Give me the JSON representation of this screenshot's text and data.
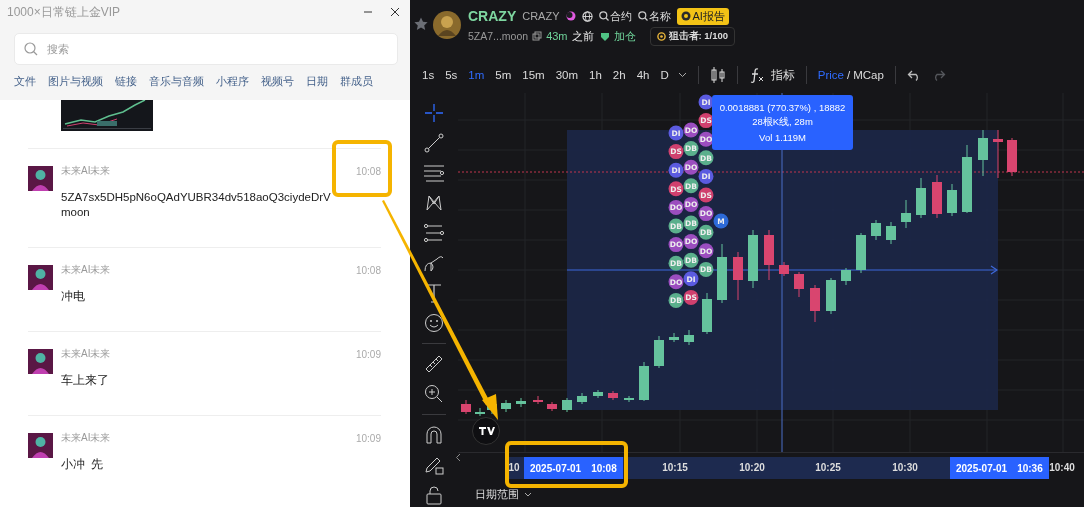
{
  "chat": {
    "title": "1000×日常链上金VIP",
    "search": {
      "placeholder": "搜索"
    },
    "tabs": [
      {
        "label": "文件"
      },
      {
        "label": "图片与视频"
      },
      {
        "label": "链接"
      },
      {
        "label": "音乐与音频"
      },
      {
        "label": "小程序"
      },
      {
        "label": "视频号"
      },
      {
        "label": "日期"
      },
      {
        "label": "群成员"
      }
    ],
    "messages": [
      {
        "sender": "未来AI未来",
        "time": "10:08",
        "text": "5ZA7sx5DH5pN6oQAdYUBR34dv518aoQ3ciydeDrVmoon"
      },
      {
        "sender": "未来AI未来",
        "time": "10:08",
        "text": "冲电"
      },
      {
        "sender": "未来AI未来",
        "time": "10:09",
        "text": "车上来了"
      },
      {
        "sender": "未来AI未来",
        "time": "10:09",
        "text": "小冲  先"
      }
    ]
  },
  "token": {
    "name": "CRAZY",
    "symbol": "CRAZY",
    "links": [
      "合约",
      "名称"
    ],
    "ai_report": "AI报告",
    "address": "5ZA7...moon",
    "age": "43m",
    "age_suffix": "之前",
    "tag": "加仓",
    "snipers": "狙击者: 1/100"
  },
  "toolbar": {
    "intervals": [
      {
        "label": "1s",
        "selected": false
      },
      {
        "label": "5s",
        "selected": false
      },
      {
        "label": "1m",
        "selected": true
      },
      {
        "label": "5m",
        "selected": false
      },
      {
        "label": "15m",
        "selected": false
      },
      {
        "label": "30m",
        "selected": false
      },
      {
        "label": "1h",
        "selected": false
      },
      {
        "label": "2h",
        "selected": false
      },
      {
        "label": "4h",
        "selected": false
      },
      {
        "label": "D",
        "selected": false
      }
    ],
    "indicators": "指标",
    "units": [
      {
        "label": "Price",
        "selected": true
      },
      {
        "label": "MCap",
        "selected": false
      }
    ],
    "unit_separator": "/",
    "undo_disabled": false,
    "redo_disabled": true
  },
  "chart": {
    "tooltip": [
      "0.0018881 (770.37%) , 18882",
      "28根K线, 28m",
      "Vol 1.119M"
    ],
    "marker_columns": [
      [
        {
          "label": "DI",
          "color": "#5b5be0"
        },
        {
          "label": "DS",
          "color": "#d0406e"
        },
        {
          "label": "DI",
          "color": "#5b5be0"
        },
        {
          "label": "DS",
          "color": "#d0406e"
        },
        {
          "label": "DO",
          "color": "#9b4dbf"
        },
        {
          "label": "DB",
          "color": "#5aaf8c"
        },
        {
          "label": "DO",
          "color": "#9b4dbf"
        },
        {
          "label": "DB",
          "color": "#5aaf8c"
        },
        {
          "label": "DO",
          "color": "#9b4dbf"
        },
        {
          "label": "DB",
          "color": "#5aaf8c"
        }
      ],
      [
        {
          "label": "DO",
          "color": "#9b4dbf"
        },
        {
          "label": "DB",
          "color": "#5aaf8c"
        },
        {
          "label": "DO",
          "color": "#9b4dbf"
        },
        {
          "label": "DB",
          "color": "#5aaf8c"
        },
        {
          "label": "DO",
          "color": "#9b4dbf"
        },
        {
          "label": "DB",
          "color": "#5aaf8c"
        },
        {
          "label": "DO",
          "color": "#9b4dbf"
        },
        {
          "label": "DB",
          "color": "#5aaf8c"
        },
        {
          "label": "DI",
          "color": "#5b5be0"
        },
        {
          "label": "DS",
          "color": "#d0406e"
        }
      ],
      [
        {
          "label": "DI",
          "color": "#5b5be0"
        },
        {
          "label": "DS",
          "color": "#d0406e"
        },
        {
          "label": "DO",
          "color": "#9b4dbf"
        },
        {
          "label": "DB",
          "color": "#5aaf8c"
        },
        {
          "label": "DI",
          "color": "#5b5be0"
        },
        {
          "label": "DS",
          "color": "#d0406e"
        },
        {
          "label": "DO",
          "color": "#9b4dbf"
        },
        {
          "label": "DB",
          "color": "#5aaf8c"
        },
        {
          "label": "DO",
          "color": "#9b4dbf"
        },
        {
          "label": "DB",
          "color": "#5aaf8c"
        }
      ],
      [
        {
          "label": "M",
          "color": "#2d6ad8"
        }
      ]
    ]
  },
  "time_axis": {
    "labels": [
      "10",
      "10:15",
      "10:20",
      "10:25",
      "10:30",
      "10:40"
    ],
    "cursor_labels": [
      {
        "date": "2025-07-01",
        "time": "10:08"
      },
      {
        "date": "2025-07-01",
        "time": "10:36"
      }
    ]
  },
  "date_range": "日期范围"
}
